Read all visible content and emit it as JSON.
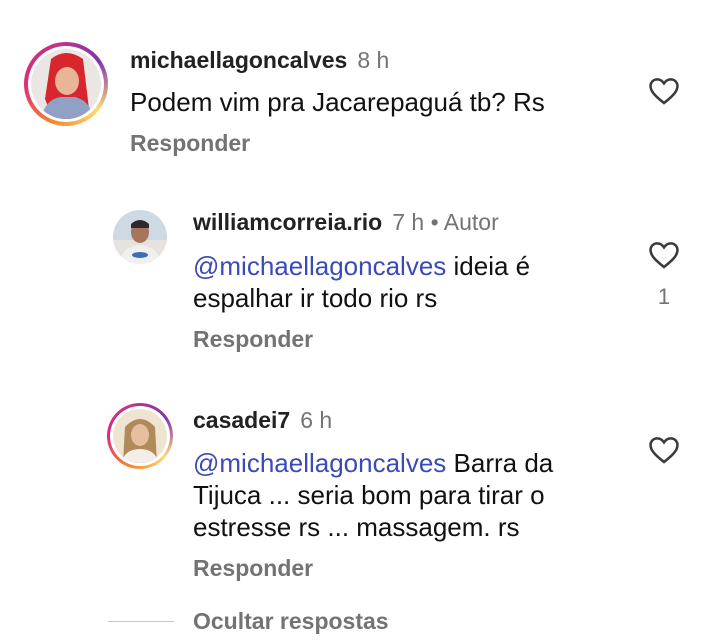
{
  "comments": [
    {
      "username": "michaellagoncalves",
      "time": "8 h",
      "author_tag": "",
      "mention": "",
      "text": "Podem vim pra Jacarepaguá tb? Rs",
      "reply_label": "Responder",
      "like_count": ""
    },
    {
      "username": "williamcorreia.rio",
      "time": "7 h",
      "author_tag": "• Autor",
      "mention": "@michaellagoncalves",
      "text": " ideia é espalhar ir todo rio rs",
      "reply_label": "Responder",
      "like_count": "1"
    },
    {
      "username": "casadei7",
      "time": "6 h",
      "author_tag": "",
      "mention": "@michaellagoncalves",
      "text": " Barra da Tijuca ... seria bom para tirar o estresse rs ... massagem. rs",
      "reply_label": "Responder",
      "like_count": ""
    }
  ],
  "hide_replies_label": "Ocultar respostas",
  "icons": {
    "like": "heart-outline-icon"
  },
  "colors": {
    "mention": "#3a4bb8",
    "muted": "#737373",
    "story_ring": "#dd2a7b"
  }
}
